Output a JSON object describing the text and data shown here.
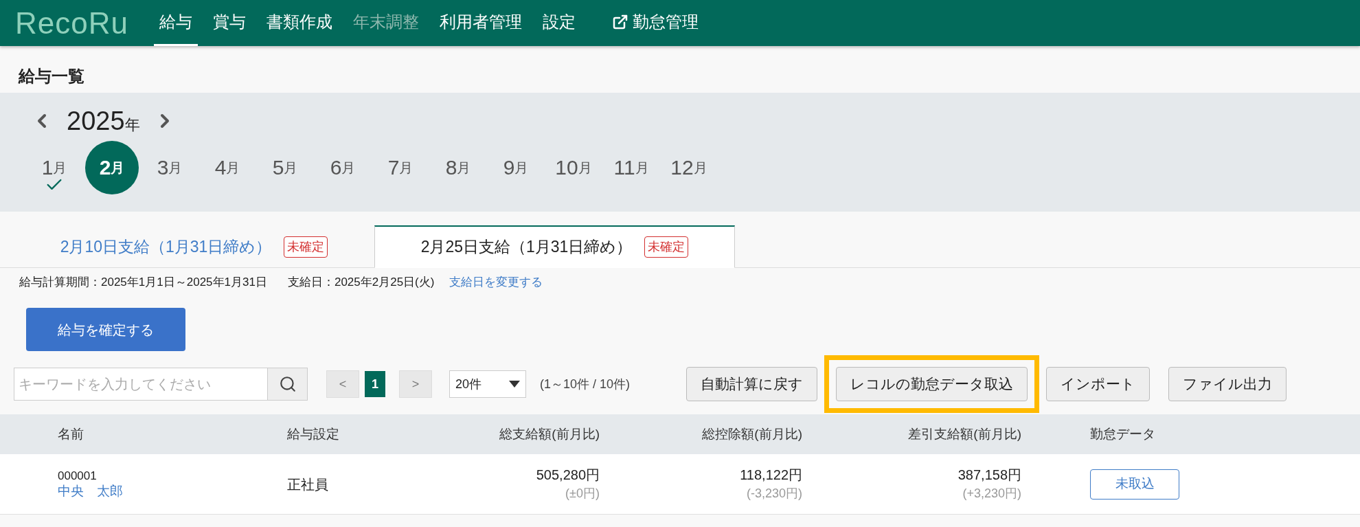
{
  "logo": "RecoRu",
  "nav": [
    {
      "label": "給与",
      "selected": true,
      "disabled": false,
      "kind": "page"
    },
    {
      "label": "賞与",
      "selected": false,
      "disabled": false,
      "kind": "page"
    },
    {
      "label": "書類作成",
      "selected": false,
      "disabled": false,
      "kind": "page"
    },
    {
      "label": "年末調整",
      "selected": false,
      "disabled": true,
      "kind": "page"
    },
    {
      "label": "利用者管理",
      "selected": false,
      "disabled": false,
      "kind": "page"
    },
    {
      "label": "設定",
      "selected": false,
      "disabled": false,
      "kind": "page"
    },
    {
      "label": "勤怠管理",
      "selected": false,
      "disabled": false,
      "kind": "external"
    }
  ],
  "page_title": "給与一覧",
  "year": {
    "value": "2025",
    "unit": "年"
  },
  "months": [
    {
      "number": "1",
      "unit": "月",
      "selected": false,
      "checked": true
    },
    {
      "number": "2",
      "unit": "月",
      "selected": true,
      "checked": false
    },
    {
      "number": "3",
      "unit": "月",
      "selected": false,
      "checked": false
    },
    {
      "number": "4",
      "unit": "月",
      "selected": false,
      "checked": false
    },
    {
      "number": "5",
      "unit": "月",
      "selected": false,
      "checked": false
    },
    {
      "number": "6",
      "unit": "月",
      "selected": false,
      "checked": false
    },
    {
      "number": "7",
      "unit": "月",
      "selected": false,
      "checked": false
    },
    {
      "number": "8",
      "unit": "月",
      "selected": false,
      "checked": false
    },
    {
      "number": "9",
      "unit": "月",
      "selected": false,
      "checked": false
    },
    {
      "number": "10",
      "unit": "月",
      "selected": false,
      "checked": false
    },
    {
      "number": "11",
      "unit": "月",
      "selected": false,
      "checked": false
    },
    {
      "number": "12",
      "unit": "月",
      "selected": false,
      "checked": false
    }
  ],
  "tabs": [
    {
      "label": "2月10日支給（1月31日締め）",
      "badge": "未確定",
      "selected": false
    },
    {
      "label": "2月25日支給（1月31日締め）",
      "badge": "未確定",
      "selected": true
    }
  ],
  "info": {
    "period": "給与計算期間：2025年1月1日～2025年1月31日",
    "pay_date": "支給日：2025年2月25日(火)",
    "change_link": "支給日を変更する"
  },
  "confirm_button": "給与を確定する",
  "search": {
    "placeholder": "キーワードを入力してください"
  },
  "pagination": {
    "prev": "<",
    "pages": [
      {
        "label": "1",
        "selected": true
      }
    ],
    "next": ">",
    "per_page": "20件",
    "summary": "(1～10件 / 10件)"
  },
  "actions": [
    {
      "label": "自動計算に戻す",
      "highlighted": false
    },
    {
      "label": "レコルの勤怠データ取込",
      "highlighted": true
    },
    {
      "label": "インポート",
      "highlighted": false
    },
    {
      "label": "ファイル出力",
      "highlighted": false
    }
  ],
  "table": {
    "columns": [
      "名前",
      "給与設定",
      "総支給額(前月比)",
      "総控除額(前月比)",
      "差引支給額(前月比)",
      "勤怠データ"
    ],
    "rows": [
      {
        "id": "000001",
        "name": "中央　太郎",
        "setting": "正社員",
        "gross": "505,280円",
        "gross_diff": "(±0円)",
        "deduction": "118,122円",
        "deduction_diff": "(-3,230円)",
        "net": "387,158円",
        "net_diff": "(+3,230円)",
        "attendance": "未取込"
      }
    ]
  }
}
